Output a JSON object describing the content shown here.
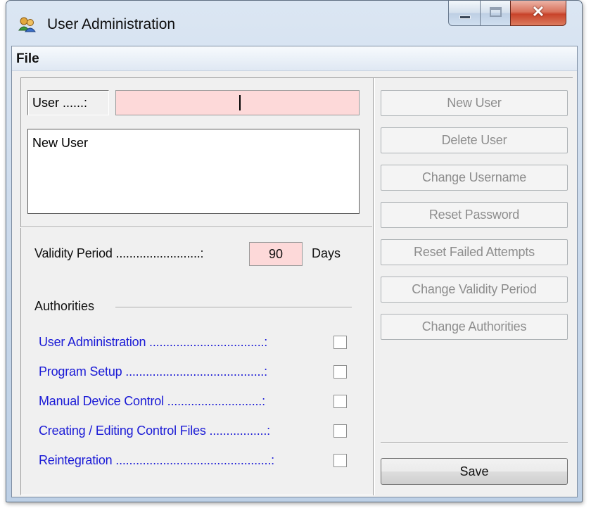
{
  "window": {
    "title": "User Administration"
  },
  "menu": {
    "file": "File"
  },
  "user_form": {
    "user_label": "User ......:",
    "user_value": "",
    "list_items": [
      "New User"
    ]
  },
  "validity": {
    "label": "Validity Period .........................:",
    "value": "90",
    "unit": "Days"
  },
  "authorities": {
    "heading": "Authorities",
    "items": [
      {
        "label": "User Administration ..................................:",
        "checked": false
      },
      {
        "label": "Program Setup .........................................:",
        "checked": false
      },
      {
        "label": "Manual Device Control ............................:",
        "checked": false
      },
      {
        "label": "Creating / Editing Control Files .................:",
        "checked": false
      },
      {
        "label": "Reintegration ..............................................:",
        "checked": false
      }
    ]
  },
  "actions": {
    "new_user": "New User",
    "delete_user": "Delete User",
    "change_username": "Change Username",
    "reset_password": "Reset Password",
    "reset_failed_attempts": "Reset Failed Attempts",
    "change_validity_period": "Change Validity Period",
    "change_authorities": "Change Authorities",
    "save": "Save"
  },
  "colors": {
    "required_field": "#fdd9d9",
    "authority_label": "#1a1ad6",
    "disabled_text": "#8d8d8d"
  }
}
